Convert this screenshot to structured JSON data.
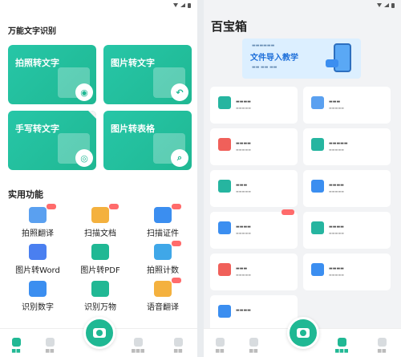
{
  "left": {
    "section_title": "万能文字识别",
    "cards": [
      {
        "title": "拍照转文字",
        "badge": "camera-icon"
      },
      {
        "title": "图片转文字",
        "badge": "reply-arrow-icon"
      },
      {
        "title": "手写转文字",
        "badge": "eye-icon"
      },
      {
        "title": "图片转表格",
        "badge": "magnifier-icon"
      }
    ],
    "functions_title": "实用功能",
    "functions": [
      {
        "label": "拍照翻译",
        "color": "#5aa0f0"
      },
      {
        "label": "扫描文档",
        "color": "#f4b13e"
      },
      {
        "label": "扫描证件",
        "color": "#3b8ef0"
      },
      {
        "label": "图片转Word",
        "color": "#4a7ff0"
      },
      {
        "label": "图片转PDF",
        "color": "#20b894"
      },
      {
        "label": "拍照计数",
        "color": "#3fa7e8"
      },
      {
        "label": "识别数字",
        "color": "#3b8ef0"
      },
      {
        "label": "识别万物",
        "color": "#20b894"
      },
      {
        "label": "语音翻译",
        "color": "#f4b13e"
      }
    ]
  },
  "right": {
    "title": "百宝箱",
    "banner_title": "文件导入教学",
    "tools": [
      {
        "icon": "document-scan-icon",
        "color": "#26b5a0"
      },
      {
        "icon": "translate-icon",
        "color": "#5aa0f0"
      },
      {
        "icon": "pdf-icon",
        "color": "#f0605a"
      },
      {
        "icon": "video-icon",
        "color": "#26b5a0"
      },
      {
        "icon": "scan-text-icon",
        "color": "#26b5a0"
      },
      {
        "icon": "cloud-icon",
        "color": "#3b8ef0"
      },
      {
        "icon": "ai-document-icon",
        "color": "#3b8ef0"
      },
      {
        "icon": "image-edit-icon",
        "color": "#26b5a0"
      },
      {
        "icon": "eraser-icon",
        "color": "#f0605a"
      },
      {
        "icon": "ai-image-icon",
        "color": "#3b8ef0"
      },
      {
        "icon": "qr-code-icon",
        "color": "#3b8ef0"
      }
    ]
  },
  "colors": {
    "accent": "#1fb893",
    "brand_blue": "#1e6fd9"
  }
}
